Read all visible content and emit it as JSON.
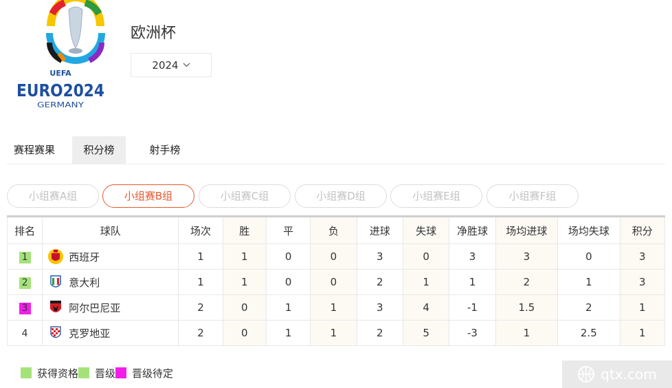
{
  "header": {
    "logo_text": "EURO2024",
    "logo_sub": "GERMANY",
    "logo_top": "UEFA",
    "title": "欧洲杯",
    "season": "2024"
  },
  "tabs": [
    {
      "label": "赛程赛果",
      "active": false
    },
    {
      "label": "积分榜",
      "active": true
    },
    {
      "label": "射手榜",
      "active": false
    }
  ],
  "groups": [
    {
      "label": "小组赛A组",
      "active": false
    },
    {
      "label": "小组赛B组",
      "active": true
    },
    {
      "label": "小组赛C组",
      "active": false
    },
    {
      "label": "小组赛D组",
      "active": false
    },
    {
      "label": "小组赛E组",
      "active": false
    },
    {
      "label": "小组赛F组",
      "active": false
    }
  ],
  "table": {
    "headers": [
      "排名",
      "球队",
      "场次",
      "胜",
      "平",
      "负",
      "进球",
      "失球",
      "净胜球",
      "场均进球",
      "场均失球",
      "积分"
    ],
    "rows": [
      {
        "rank": "1",
        "rank_color": "#a6e27a",
        "team": "西班牙",
        "flag": "spain-crest",
        "played": "1",
        "won": "1",
        "draw": "0",
        "lost": "0",
        "gf": "3",
        "ga": "0",
        "gd": "3",
        "avg_gf": "3",
        "avg_ga": "0",
        "pts": "3"
      },
      {
        "rank": "2",
        "rank_color": "#a6e27a",
        "team": "意大利",
        "flag": "italy-crest",
        "played": "1",
        "won": "1",
        "draw": "0",
        "lost": "0",
        "gf": "2",
        "ga": "1",
        "gd": "1",
        "avg_gf": "2",
        "avg_ga": "1",
        "pts": "3"
      },
      {
        "rank": "3",
        "rank_color": "#f21ee8",
        "team": "阿尔巴尼亚",
        "flag": "albania-crest",
        "played": "2",
        "won": "0",
        "draw": "1",
        "lost": "1",
        "gf": "3",
        "ga": "4",
        "gd": "-1",
        "avg_gf": "1.5",
        "avg_ga": "2",
        "pts": "1"
      },
      {
        "rank": "4",
        "rank_color": "",
        "team": "克罗地亚",
        "flag": "croatia-crest",
        "played": "2",
        "won": "0",
        "draw": "1",
        "lost": "1",
        "gf": "2",
        "ga": "5",
        "gd": "-3",
        "avg_gf": "1",
        "avg_ga": "2.5",
        "pts": "1"
      }
    ]
  },
  "legend": [
    {
      "label": "获得资格",
      "color": "#a6e27a"
    },
    {
      "label": "晋级",
      "color": "#a6e27a"
    },
    {
      "label": "晋级待定",
      "color": "#f21ee8"
    }
  ],
  "watermark": "qtx.com",
  "colors": {
    "accent": "#e8572d",
    "shade": "#fdfaf4",
    "border": "#e8e8e8"
  }
}
